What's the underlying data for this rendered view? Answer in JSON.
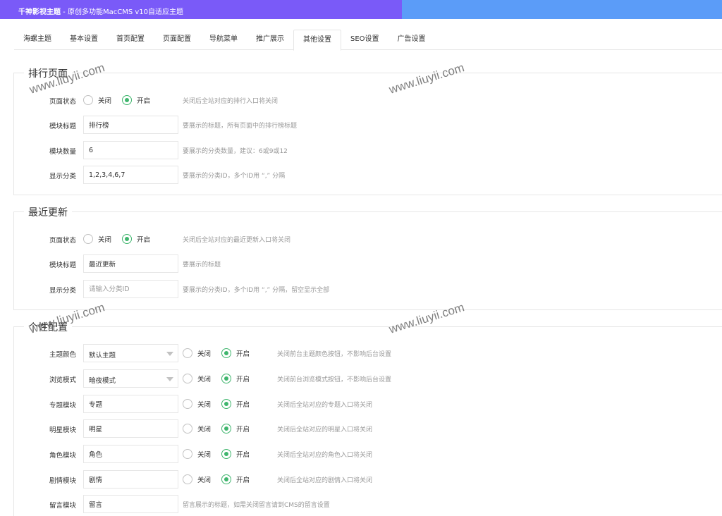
{
  "header": {
    "brand": "千神影视主题",
    "subtitle": " - 原创多功能MacCMS v10自适应主题",
    "brand_color": "#7a5af8",
    "accent_color": "#5b9cf8"
  },
  "tabs": [
    {
      "label": "海螺主题"
    },
    {
      "label": "基本设置"
    },
    {
      "label": "首页配置"
    },
    {
      "label": "页面配置"
    },
    {
      "label": "导航菜单"
    },
    {
      "label": "推广展示"
    },
    {
      "label": "其他设置",
      "active": true
    },
    {
      "label": "SEO设置"
    },
    {
      "label": "广告设置"
    }
  ],
  "radio_off_label": "关闭",
  "radio_on_label": "开启",
  "radio_selected_color": "#3fb56d",
  "ranking": {
    "legend": "排行页面",
    "status_label": "页面状态",
    "status_hint": "关闭后全站对应的排行入口将关闭",
    "title_label": "模块标题",
    "title_value": "排行榜",
    "title_hint": "要展示的标题，所有页面中的排行榜标题",
    "count_label": "模块数量",
    "count_value": "6",
    "count_hint": "要展示的分类数量，建议：6或9或12",
    "cats_label": "显示分类",
    "cats_value": "1,2,3,4,6,7",
    "cats_hint": "要展示的分类ID，多个ID用 “,” 分隔"
  },
  "recent": {
    "legend": "最近更新",
    "status_label": "页面状态",
    "status_hint": "关闭后全站对应的最近更新入口将关闭",
    "title_label": "模块标题",
    "title_value": "最近更新",
    "title_hint": "要展示的标题",
    "cats_label": "显示分类",
    "cats_placeholder": "请输入分类ID",
    "cats_hint": "要展示的分类ID，多个ID用 “,” 分隔，留空显示全部"
  },
  "personal": {
    "legend": "个性配置",
    "rows": [
      {
        "label": "主题颜色",
        "value": "默认主题",
        "type": "select",
        "hint": "关闭前台主题颜色按钮，不影响后台设置"
      },
      {
        "label": "浏览模式",
        "value": "暗夜模式",
        "type": "select",
        "hint": "关闭前台浏览模式按钮，不影响后台设置"
      },
      {
        "label": "专题模块",
        "value": "专题",
        "type": "input",
        "hint": "关闭后全站对应的专题入口将关闭"
      },
      {
        "label": "明星模块",
        "value": "明星",
        "type": "input",
        "hint": "关闭后全站对应的明星入口将关闭"
      },
      {
        "label": "角色模块",
        "value": "角色",
        "type": "input",
        "hint": "关闭后全站对应的角色入口将关闭"
      },
      {
        "label": "剧情模块",
        "value": "剧情",
        "type": "input",
        "hint": "关闭后全站对应的剧情入口将关闭"
      }
    ],
    "message_label": "留言模块",
    "message_value": "留言",
    "message_hint": "留言展示的标题，如需关闭留言请到CMS的留言设置"
  },
  "watermark": "www.liuyii.com"
}
